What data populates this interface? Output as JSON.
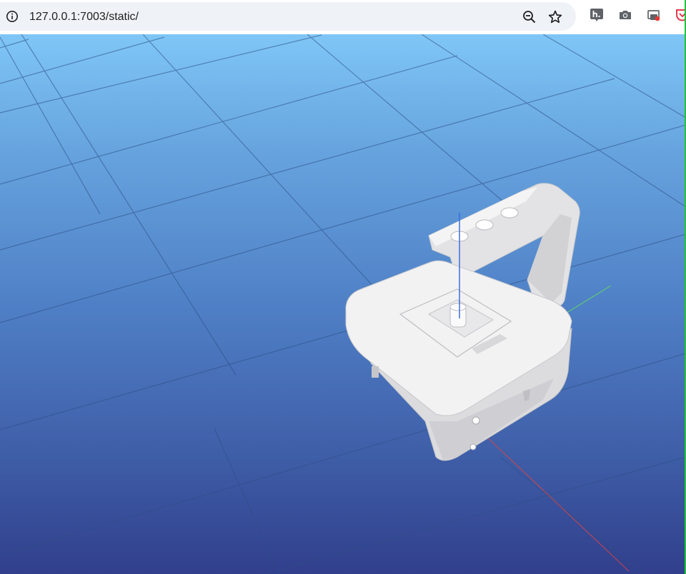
{
  "browser": {
    "url": "127.0.0.1:7003/static/",
    "icons": {
      "site_info": "info-icon",
      "zoom": "zoom-out-icon",
      "bookmark": "star-icon",
      "extensions": [
        "hypothesis-extension-icon",
        "camera-extension-icon",
        "screen-capture-extension-icon",
        "pocket-extension-icon"
      ]
    }
  },
  "viewport": {
    "scene": "3d-robot-viewer",
    "object": "white-robot-with-handle-on-grid-floor",
    "colors": {
      "sky_top": "#7fc6f6",
      "sky_bottom": "#313f8c",
      "grid": "#2d4f86",
      "robot": "#f2f2f2",
      "axis_x": "#d64545",
      "axis_y": "#5fd16a",
      "axis_z": "#3a6ee0"
    }
  }
}
